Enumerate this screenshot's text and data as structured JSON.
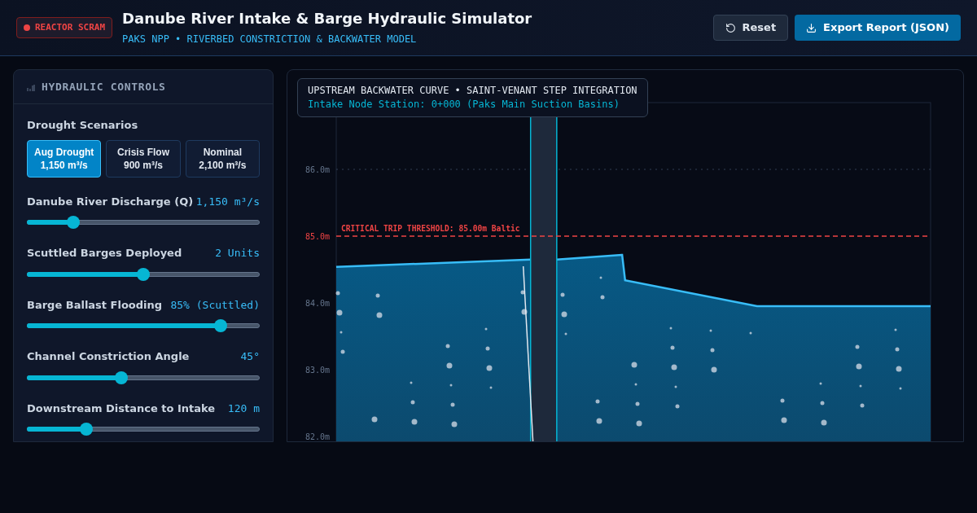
{
  "header": {
    "badge": "REACTOR SCRAM",
    "title": "Danube River Intake & Barge Hydraulic Simulator",
    "subtitle": "PAKS NPP • RIVERBED CONSTRICTION & BACKWATER MODEL",
    "buttons": [
      {
        "kind": "reset",
        "label": "Reset"
      },
      {
        "kind": "export",
        "label": "Export Report (JSON)"
      }
    ]
  },
  "controls": {
    "title": "HYDRAULIC CONTROLS",
    "scenarios_label": "Drought Scenarios",
    "scenarios": [
      {
        "name": "Aug Drought",
        "flow": "1,150 m³/s",
        "selected": true
      },
      {
        "name": "Crisis Flow",
        "flow": "900 m³/s",
        "selected": false
      },
      {
        "name": "Nominal",
        "flow": "2,100 m³/s",
        "selected": false
      }
    ],
    "sliders": [
      {
        "label": "Danube River Discharge (Q)",
        "reading": "1,150 m³/s",
        "level": 0.18
      },
      {
        "label": "Scuttled Barges Deployed",
        "reading": "2 Units",
        "level": 0.5
      },
      {
        "label": "Barge Ballast Flooding",
        "reading": "85% (Scuttled)",
        "level": 0.85
      },
      {
        "label": "Channel Constriction Angle",
        "reading": "45°",
        "level": 0.4
      },
      {
        "label": "Downstream Distance to Intake",
        "reading": "120 m",
        "level": 0.24
      }
    ]
  },
  "chart_panel": {
    "legend_title": "UPSTREAM BACKWATER CURVE • SAINT-VENANT STEP INTEGRATION",
    "legend_subtitle": "Intake Node Station: 0+000 (Paks Main Suction Basins)",
    "axis_labels": [
      "86.0m",
      "85.0m",
      "84.0m",
      "83.0m",
      "82.0m"
    ],
    "threshold_label": "CRITICAL TRIP THRESHOLD: 85.00m Baltic"
  }
}
